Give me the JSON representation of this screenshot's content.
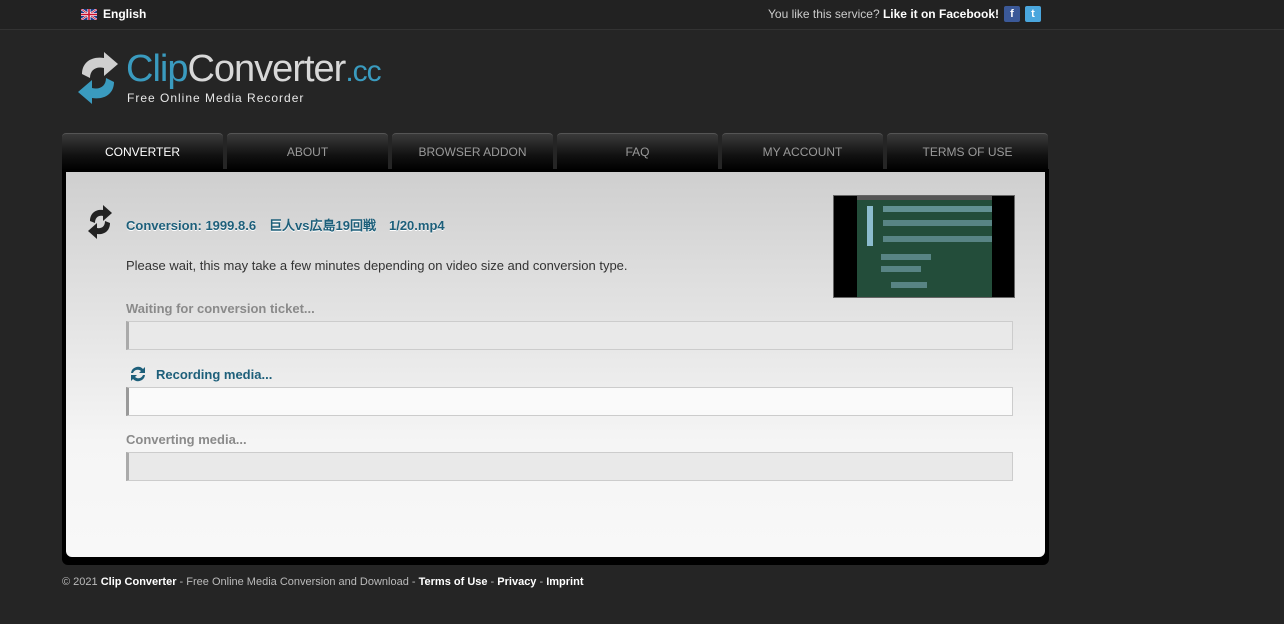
{
  "topbar": {
    "language": "English",
    "social_prefix": "You like this service?",
    "social_like": "Like it on",
    "social_brand": "Facebook",
    "social_suffix": "!"
  },
  "logo": {
    "part1": "Clip",
    "part2": "Converter",
    "part3": ".cc",
    "tagline": "Free Online Media Recorder"
  },
  "tabs": [
    {
      "label": "Converter",
      "active": true
    },
    {
      "label": "About"
    },
    {
      "label": "Browser Addon"
    },
    {
      "label": "FAQ"
    },
    {
      "label": "My Account"
    },
    {
      "label": "Terms of Use"
    }
  ],
  "conversion": {
    "title": "Conversion: 1999.8.6　巨人vs広島19回戦　1/20.mp4",
    "wait_text": "Please wait, this may take a few minutes depending on video size and conversion type."
  },
  "steps": [
    {
      "label": "Waiting for conversion ticket..."
    },
    {
      "label": "Recording media..."
    },
    {
      "label": "Converting media..."
    }
  ],
  "footer": {
    "copyright": "© 2021",
    "brand": "Clip Converter",
    "tagline": " - Free Online Media Conversion and Download - ",
    "terms": "Terms of Use",
    "sep1": " - ",
    "privacy": "Privacy",
    "sep2": " - ",
    "imprint": "Imprint"
  },
  "colors": {
    "accent": "#1d5f7a",
    "logo_blue": "#3a9bbf",
    "background": "#252525"
  }
}
